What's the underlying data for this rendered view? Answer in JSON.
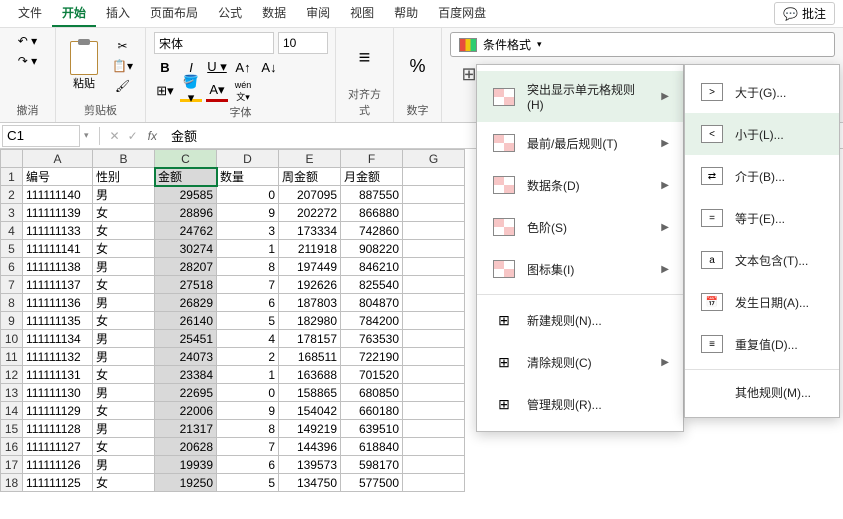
{
  "menubar": {
    "items": [
      "文件",
      "开始",
      "插入",
      "页面布局",
      "公式",
      "数据",
      "审阅",
      "视图",
      "帮助",
      "百度网盘"
    ],
    "active_index": 1,
    "comment_label": "批注"
  },
  "ribbon": {
    "undo_group": "撤消",
    "clipboard_group": "剪贴板",
    "paste_label": "粘贴",
    "font_group": "字体",
    "font_name": "宋体",
    "font_size": "10",
    "align_group": "对齐方式",
    "number_group": "数字",
    "percent": "%",
    "cond_format_label": "条件格式"
  },
  "namebox": {
    "value": "C1"
  },
  "formula": {
    "fx": "fx",
    "value": "金额"
  },
  "columns": [
    "A",
    "B",
    "C",
    "D",
    "E",
    "F",
    "G"
  ],
  "headers": {
    "A": "编号",
    "B": "性别",
    "C": "金额",
    "D": "数量",
    "E": "周金额",
    "F": "月金额"
  },
  "rows": [
    {
      "n": 1
    },
    {
      "n": 2,
      "A": "111111140",
      "B": "男",
      "C": "29585",
      "D": "0",
      "E": "207095",
      "F": "887550"
    },
    {
      "n": 3,
      "A": "111111139",
      "B": "女",
      "C": "28896",
      "D": "9",
      "E": "202272",
      "F": "866880"
    },
    {
      "n": 4,
      "A": "111111133",
      "B": "女",
      "C": "24762",
      "D": "3",
      "E": "173334",
      "F": "742860"
    },
    {
      "n": 5,
      "A": "111111141",
      "B": "女",
      "C": "30274",
      "D": "1",
      "E": "211918",
      "F": "908220"
    },
    {
      "n": 6,
      "A": "111111138",
      "B": "男",
      "C": "28207",
      "D": "8",
      "E": "197449",
      "F": "846210"
    },
    {
      "n": 7,
      "A": "111111137",
      "B": "女",
      "C": "27518",
      "D": "7",
      "E": "192626",
      "F": "825540"
    },
    {
      "n": 8,
      "A": "111111136",
      "B": "男",
      "C": "26829",
      "D": "6",
      "E": "187803",
      "F": "804870"
    },
    {
      "n": 9,
      "A": "111111135",
      "B": "女",
      "C": "26140",
      "D": "5",
      "E": "182980",
      "F": "784200"
    },
    {
      "n": 10,
      "A": "111111134",
      "B": "男",
      "C": "25451",
      "D": "4",
      "E": "178157",
      "F": "763530"
    },
    {
      "n": 11,
      "A": "111111132",
      "B": "男",
      "C": "24073",
      "D": "2",
      "E": "168511",
      "F": "722190"
    },
    {
      "n": 12,
      "A": "111111131",
      "B": "女",
      "C": "23384",
      "D": "1",
      "E": "163688",
      "F": "701520"
    },
    {
      "n": 13,
      "A": "111111130",
      "B": "男",
      "C": "22695",
      "D": "0",
      "E": "158865",
      "F": "680850"
    },
    {
      "n": 14,
      "A": "111111129",
      "B": "女",
      "C": "22006",
      "D": "9",
      "E": "154042",
      "F": "660180"
    },
    {
      "n": 15,
      "A": "111111128",
      "B": "男",
      "C": "21317",
      "D": "8",
      "E": "149219",
      "F": "639510"
    },
    {
      "n": 16,
      "A": "111111127",
      "B": "女",
      "C": "20628",
      "D": "7",
      "E": "144396",
      "F": "618840"
    },
    {
      "n": 17,
      "A": "111111126",
      "B": "男",
      "C": "19939",
      "D": "6",
      "E": "139573",
      "F": "598170"
    },
    {
      "n": 18,
      "A": "111111125",
      "B": "女",
      "C": "19250",
      "D": "5",
      "E": "134750",
      "F": "577500"
    }
  ],
  "cf_menu": {
    "items": [
      {
        "label": "突出显示单元格规则(H)",
        "arrow": true,
        "highlight": true
      },
      {
        "label": "最前/最后规则(T)",
        "arrow": true
      },
      {
        "label": "数据条(D)",
        "arrow": true
      },
      {
        "label": "色阶(S)",
        "arrow": true
      },
      {
        "label": "图标集(I)",
        "arrow": true
      }
    ],
    "items2": [
      {
        "label": "新建规则(N)..."
      },
      {
        "label": "清除规则(C)",
        "arrow": true
      },
      {
        "label": "管理规则(R)..."
      }
    ]
  },
  "sub_menu": {
    "items": [
      {
        "label": "大于(G)...",
        "op": ">"
      },
      {
        "label": "小于(L)...",
        "op": "<",
        "highlight": true
      },
      {
        "label": "介于(B)...",
        "op": "⇄"
      },
      {
        "label": "等于(E)...",
        "op": "="
      },
      {
        "label": "文本包含(T)...",
        "op": "a"
      },
      {
        "label": "发生日期(A)...",
        "op": "📅"
      },
      {
        "label": "重复值(D)...",
        "op": "≡"
      }
    ],
    "other": "其他规则(M)..."
  }
}
